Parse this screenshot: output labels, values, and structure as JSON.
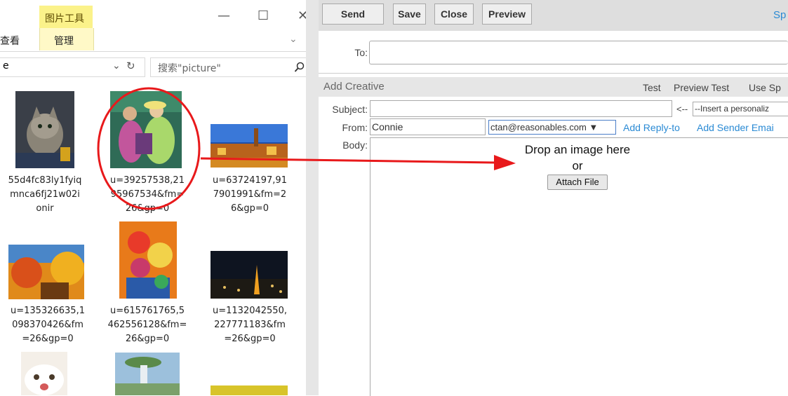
{
  "explorer": {
    "ribbon": {
      "picture_tools": "图片工具",
      "view_tab": "查看",
      "manage_tab": "管理"
    },
    "window_controls": {
      "minimize": "—",
      "maximize": "☐",
      "close": "✕"
    },
    "address": {
      "text": "e",
      "dropdown": "⌄",
      "refresh": "↻"
    },
    "search": {
      "placeholder": "搜索\"picture\""
    },
    "files": [
      {
        "name": "55d4fc83ly1fyiq mnca6fj21w02i onir",
        "lines": [
          "55d4fc83ly1fyiq",
          "mnca6fj21w02i",
          "onir"
        ]
      },
      {
        "name": "u=39257538,2195967534&fm=26&gp=0",
        "lines": [
          "u=39257538,21",
          "95967534&fm=",
          "26&gp=0"
        ]
      },
      {
        "name": "u=63724197,917901991&fm=26&gp=0",
        "lines": [
          "u=63724197,91",
          "7901991&fm=2",
          "6&gp=0"
        ]
      },
      {
        "name": "u=135326635,1098370426&fm=26&gp=0",
        "lines": [
          "u=135326635,1",
          "098370426&fm",
          "=26&gp=0"
        ]
      },
      {
        "name": "u=615761765,5462556128&fm=26&gp=0",
        "lines": [
          "u=615761765,5",
          "462556128&fm=",
          "26&gp=0"
        ]
      },
      {
        "name": "u=1132042550,227771183&fm=26&gp=0",
        "lines": [
          "u=1132042550,",
          "227771183&fm",
          "=26&gp=0"
        ]
      }
    ]
  },
  "email": {
    "toolbar": {
      "send": "Send",
      "save": "Save",
      "close": "Close",
      "preview": "Preview",
      "spell": "Sp"
    },
    "to_label": "To:",
    "to_value": "",
    "section_title": "Add Creative",
    "section_actions": {
      "test": "Test",
      "preview_test": "Preview Test",
      "use": "Use Sp"
    },
    "subject_label": "Subject:",
    "subject_value": "",
    "personalize_arrow": "<--",
    "personalize_placeholder": "--Insert a personaliz",
    "from_label": "From:",
    "from_name": "Connie",
    "from_email": "ctan@reasonables.com ▼",
    "add_reply_to": "Add Reply-to",
    "add_sender_email": "Add Sender Emai",
    "body_label": "Body:",
    "drop_text": "Drop an image here",
    "or_text": "or",
    "attach_file": "Attach File"
  },
  "colors": {
    "ribbon_yellow": "#fbf28a",
    "link_blue": "#2a8ad4",
    "annotation_red": "#e8191b"
  }
}
